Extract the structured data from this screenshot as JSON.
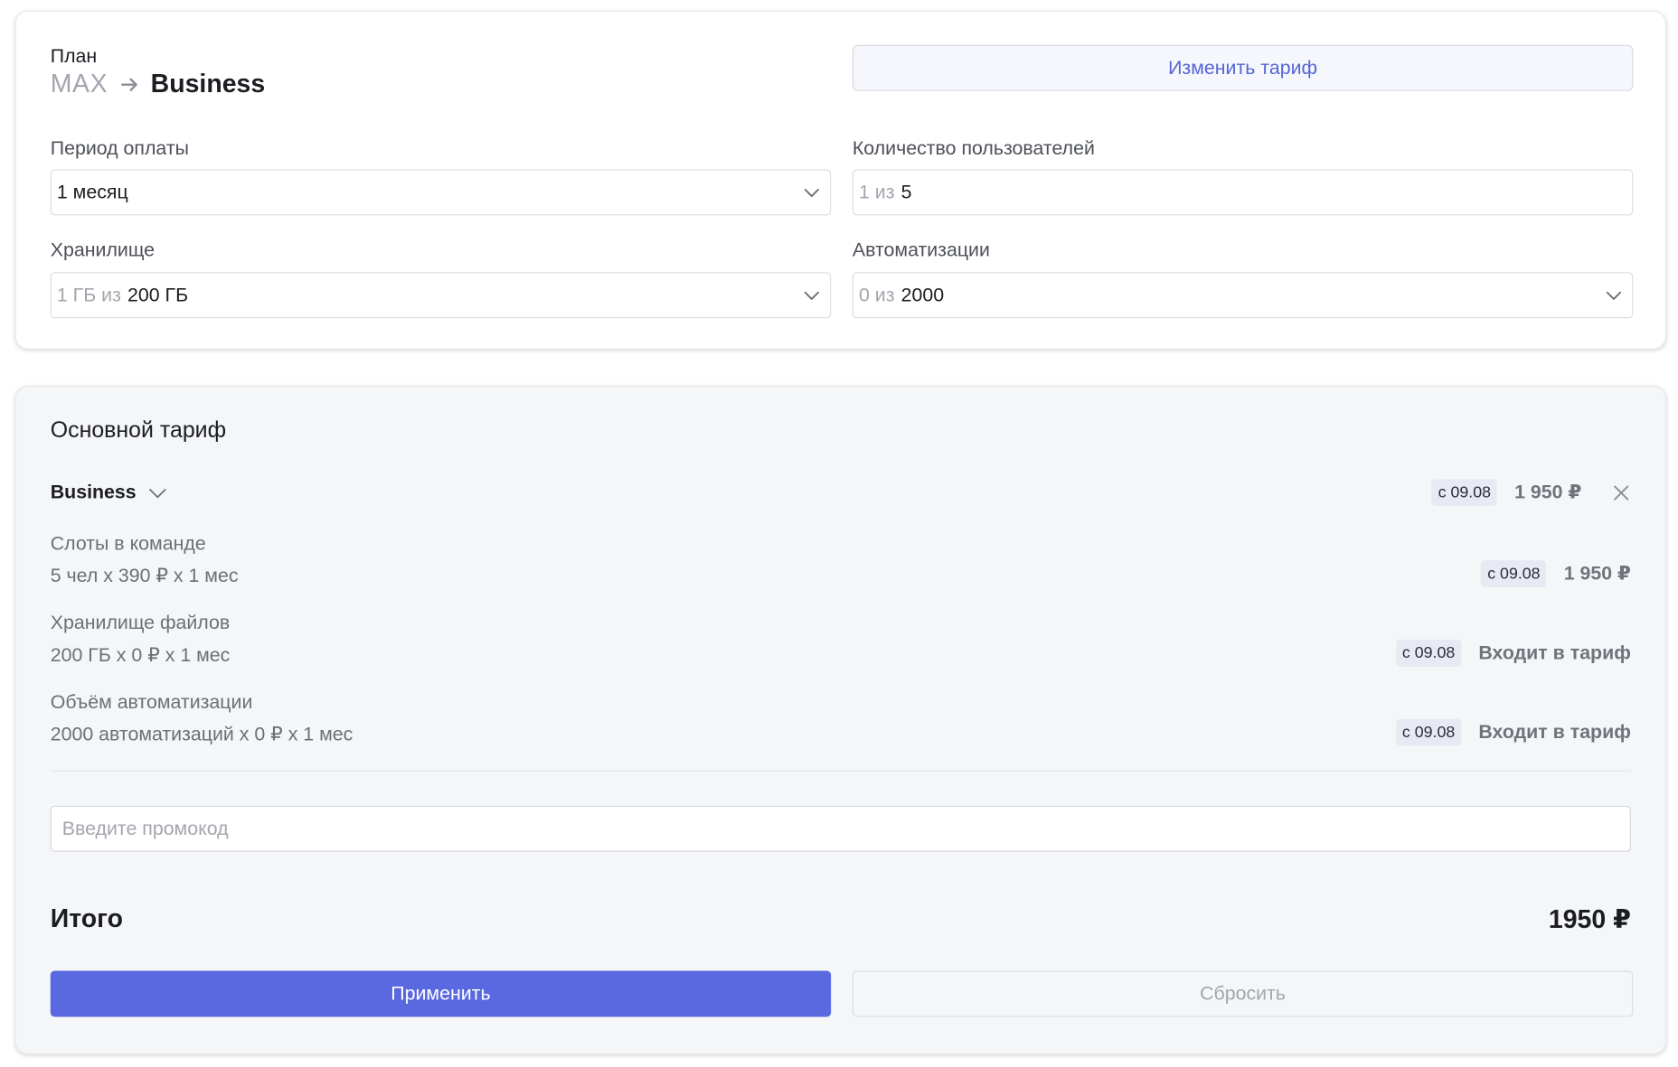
{
  "plan": {
    "label": "План",
    "from": "MAX",
    "to": "Business",
    "change_button": "Изменить тариф"
  },
  "fields": {
    "period": {
      "label": "Период оплаты",
      "value": "1 месяц"
    },
    "users": {
      "label": "Количество пользователей",
      "prefix": "1 из",
      "value": "5"
    },
    "storage": {
      "label": "Хранилище",
      "prefix": "1 ГБ из",
      "value": "200 ГБ"
    },
    "automations": {
      "label": "Автоматизации",
      "prefix": "0 из",
      "value": "2000"
    }
  },
  "summary": {
    "title": "Основной тариф",
    "plan_row": {
      "name": "Business",
      "date": "с 09.08",
      "price": "1 950 ₽"
    },
    "items": [
      {
        "title": "Слоты в команде",
        "detail": "5 чел х 390 ₽ х 1 мес",
        "date": "с 09.08",
        "price": "1 950 ₽"
      },
      {
        "title": "Хранилище файлов",
        "detail": "200 ГБ х 0 ₽ х 1 мес",
        "date": "с 09.08",
        "price": "Входит в тариф"
      },
      {
        "title": "Объём автоматизации",
        "detail": "2000 автоматизаций х 0 ₽ х 1 мес",
        "date": "с 09.08",
        "price": "Входит в тариф"
      }
    ],
    "promo_placeholder": "Введите промокод",
    "promo_value": "",
    "total_label": "Итого",
    "total_value": "1950 ₽",
    "apply_button": "Применить",
    "reset_button": "Сбросить"
  },
  "colors": {
    "accent": "#5b69e0",
    "link": "#5566d4",
    "badge_bg": "#e7e9f3"
  }
}
